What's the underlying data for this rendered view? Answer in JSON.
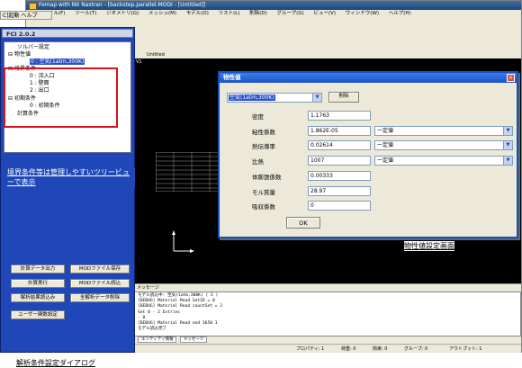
{
  "femap": {
    "title": "Femap with NX Nastran - [backstep.parallel.MODI - [Untitled]]",
    "menu": [
      "ファイル(F)",
      "ツール(T)",
      "ジオメトリ(G)",
      "メッシュ(M)",
      "モデル(O)",
      "リスト(L)",
      "削除(D)",
      "グループ(G)",
      "ビュー(V)",
      "ウィンドウ(W)",
      "ヘルプ(H)"
    ],
    "view_tab": "Untitled",
    "view_label": "V1",
    "message_header": "メッセージ",
    "messages": [
      "モデル読込中: 空気(1atm,300K) ( 2 )",
      "[DEBUG] Material Read SetID = 0",
      "[DEBUG] Material Read countSet = 2",
      "Set 0 - 2 Entries",
      "- 0",
      "[DEBUG] Material Read end 3650 1",
      "モデル読込完了"
    ],
    "message_tabs": [
      "エンティティ情報",
      "メッセージ"
    ],
    "status_cells": [
      "プロパティ: 1",
      "荷重: 0",
      "拘束: 0",
      "グループ: 0",
      "アウトプット: 1"
    ]
  },
  "fci": {
    "menu_label": "C]起動  ヘルプ",
    "title": "FCI 2.0.2",
    "tree": [
      {
        "text": "ソルバー設定"
      },
      {
        "text": "物性値",
        "expander": "⊟"
      },
      {
        "text": "0 : 空気(1atm,300K)",
        "selected": true
      },
      {
        "text": "境界条件",
        "expander": "⊟"
      },
      {
        "text": "0 : 流入口"
      },
      {
        "text": "1 : 壁面"
      },
      {
        "text": "2 : 出口"
      },
      {
        "text": "初期条件",
        "expander": "⊟"
      },
      {
        "text": "0 : 初期条件"
      },
      {
        "text": "計算条件"
      }
    ],
    "caption": "境界条件等は管理しやすいツリービューで表示",
    "buttons": {
      "calc_output": "計算データ出力",
      "mod_save": "MODファイル保存",
      "calc_run": "計算実行",
      "mod_load": "MODファイル読込",
      "result_load": "解析結果読込み",
      "delete_all": "全解析データ削除",
      "user_settings": "ユーザー関数設定"
    },
    "window_caption": "解析条件設定ダイアログ"
  },
  "dialog": {
    "title": "物性値",
    "close_glyph": "×",
    "material_value": "空気(1atm,300K)",
    "delete_label": "削除",
    "rows": [
      {
        "label": "密度",
        "value": "1.1763",
        "option": ""
      },
      {
        "label": "粘性係数",
        "value": "1.862E-05",
        "option": "一定値"
      },
      {
        "label": "熱伝導率",
        "value": "0.02614",
        "option": "一定値"
      },
      {
        "label": "比熱",
        "value": "1007",
        "option": "一定値"
      },
      {
        "label": "体膨張係数",
        "value": "0.00333",
        "option": ""
      },
      {
        "label": "モル質量",
        "value": "28.97",
        "option": ""
      },
      {
        "label": "吸収係数",
        "value": "0",
        "option": ""
      }
    ],
    "ok_label": "OK",
    "caption": "物性値設定画面"
  },
  "colors": {
    "fci_bg": "#1f47b8",
    "highlight_box": "#d8131f",
    "dialog_title": "#1853c7",
    "viewport_bg": "#000000"
  }
}
